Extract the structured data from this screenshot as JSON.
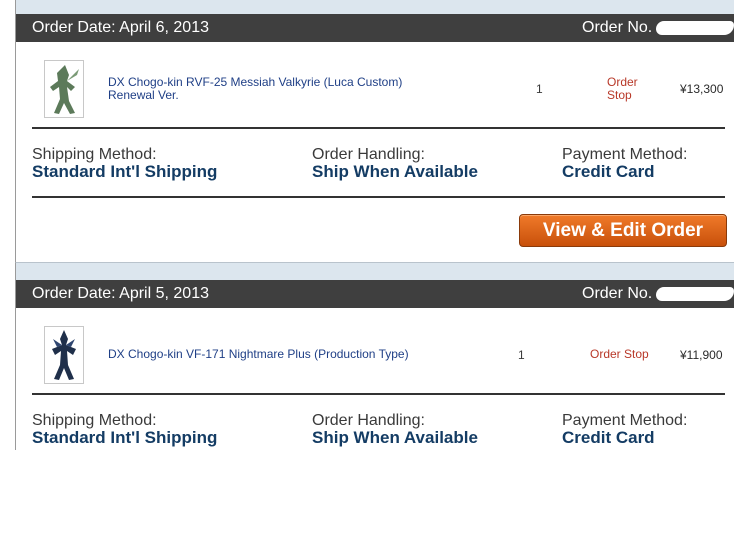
{
  "orders": [
    {
      "order_date": "Order Date: April 6, 2013",
      "order_no_label": "Order No.",
      "item": {
        "name_line1": "DX Chogo-kin RVF-25 Messiah Valkyrie (Luca Custom)",
        "name_line2": "Renewal Ver.",
        "qty": "1",
        "status_line1": "Order",
        "status_line2": "Stop",
        "price": "¥13,300"
      },
      "shipping_label": "Shipping Method:",
      "shipping_value": "Standard Int'l Shipping",
      "handling_label": "Order Handling:",
      "handling_value": "Ship When Available",
      "payment_label": "Payment Method:",
      "payment_value": "Credit Card",
      "button_label": "View & Edit Order"
    },
    {
      "order_date": "Order Date: April 5, 2013",
      "order_no_label": "Order No.",
      "item": {
        "name": "DX Chogo-kin VF-171 Nightmare Plus (Production Type)",
        "qty": "1",
        "status": "Order Stop",
        "price": "¥11,900"
      },
      "shipping_label": "Shipping Method:",
      "shipping_value": "Standard Int'l Shipping",
      "handling_label": "Order Handling:",
      "handling_value": "Ship When Available",
      "payment_label": "Payment Method:",
      "payment_value": "Credit Card"
    }
  ]
}
